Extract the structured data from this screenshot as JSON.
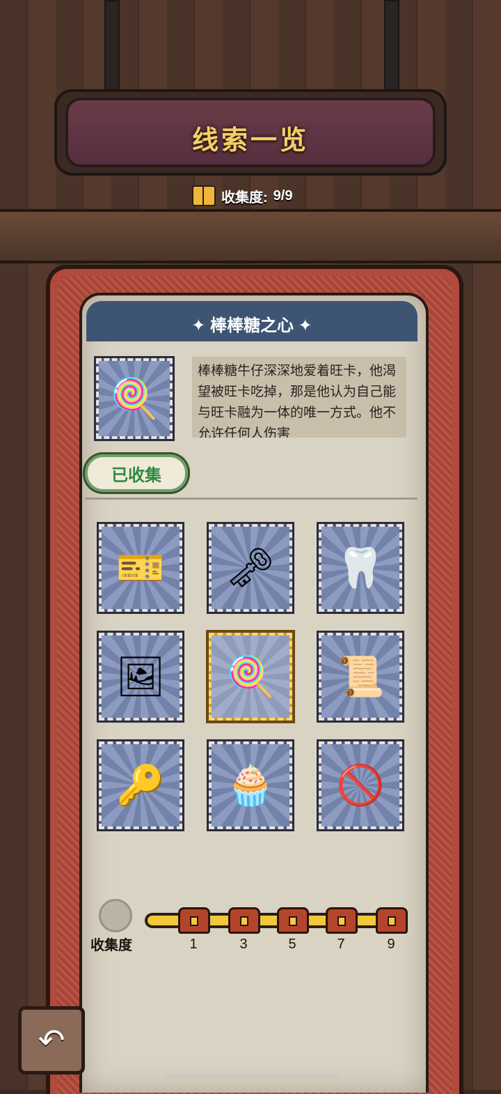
{
  "header": {
    "title": "线索一览",
    "collection_label": "收集度:",
    "collection_value": "9/9"
  },
  "selected_clue": {
    "name": "棒棒糖之心",
    "icon": "lollipop-icon",
    "description": "棒棒糖牛仔深深地爱着旺卡，他渴望被旺卡吃掉，那是他认为自己能与旺卡融为一体的唯一方式。他不允许任何人伤害",
    "status": "已收集"
  },
  "clues": [
    {
      "icon": "golden-ticket-icon",
      "glyph": "🎫",
      "selected": false
    },
    {
      "icon": "key-icon",
      "glyph": "🗝",
      "selected": false
    },
    {
      "icon": "golden-tooth-icon",
      "glyph": "🦷",
      "selected": false
    },
    {
      "icon": "photo-frame-icon",
      "glyph": "🖼",
      "selected": false
    },
    {
      "icon": "lollipop-icon",
      "glyph": "🍭",
      "selected": true
    },
    {
      "icon": "scroll-icon",
      "glyph": "📜",
      "selected": false
    },
    {
      "icon": "wind-up-key-icon",
      "glyph": "🔑",
      "selected": false
    },
    {
      "icon": "cake-icon",
      "glyph": "🧁",
      "selected": false
    },
    {
      "icon": "no-candy-icon",
      "glyph": "🚫",
      "selected": false
    }
  ],
  "progress": {
    "label": "收集度",
    "fraction": 1.0,
    "milestones": [
      "1",
      "3",
      "5",
      "7",
      "9"
    ]
  },
  "back_icon": "back-arrow-icon"
}
